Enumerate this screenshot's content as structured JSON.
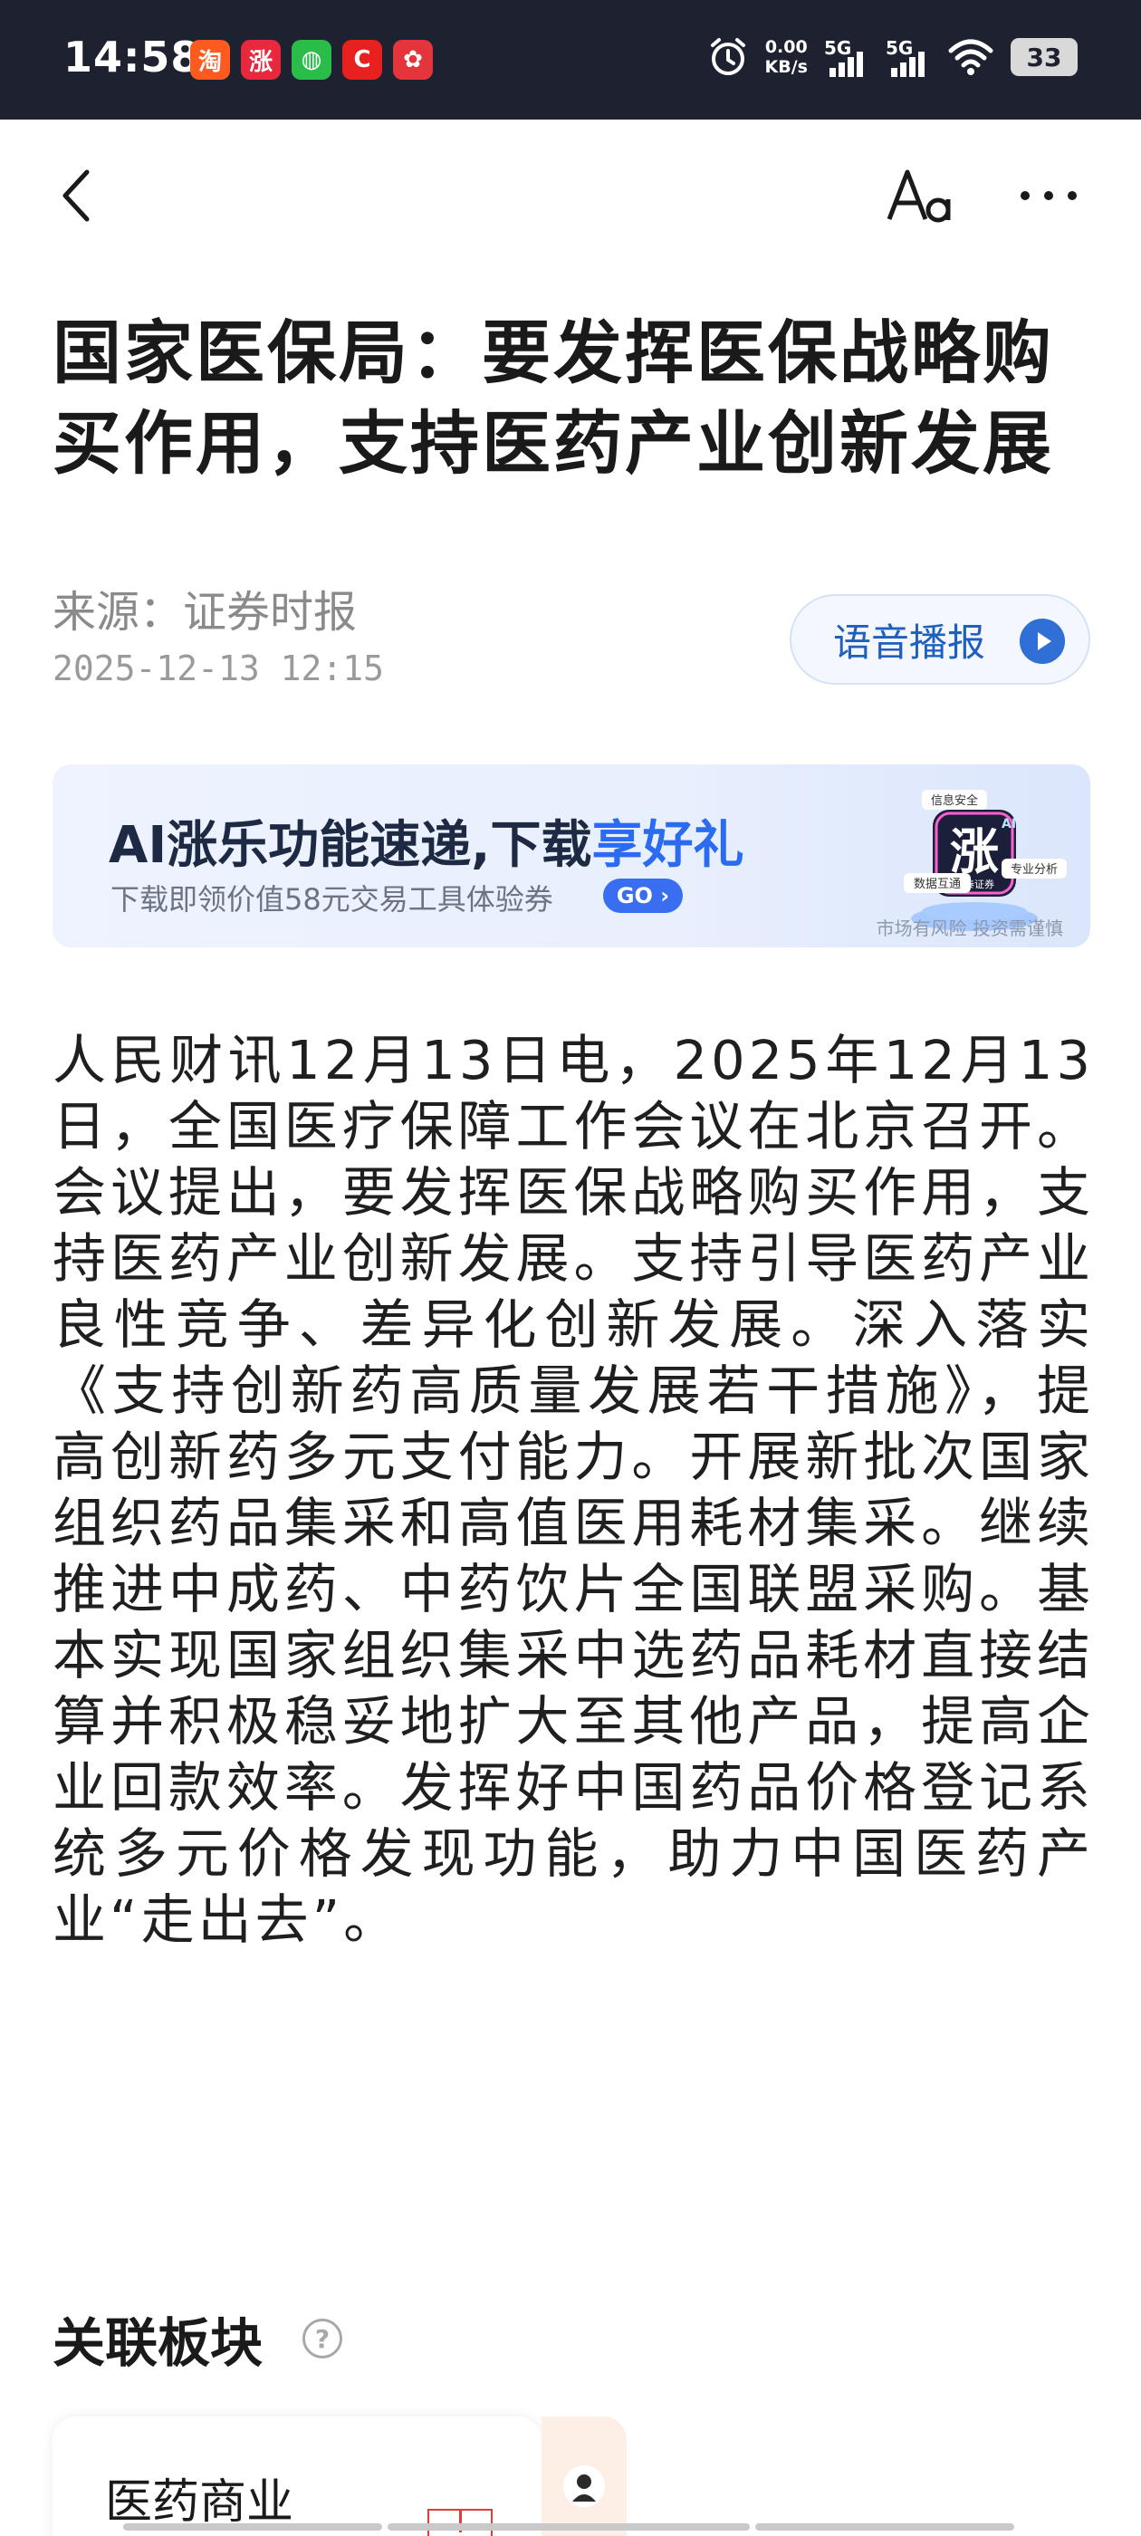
{
  "status_bar": {
    "time": "14:58",
    "apps": [
      {
        "icon": "taobao-app-icon",
        "glyph": "淘",
        "color": "#ff5a1f"
      },
      {
        "icon": "zhangle-app-icon",
        "glyph": "涨",
        "color": "#e8283c"
      },
      {
        "icon": "wechat-app-icon",
        "glyph": "◍",
        "color": "#2bbd4a"
      },
      {
        "icon": "c-app-icon",
        "glyph": "C",
        "color": "#e82020"
      },
      {
        "icon": "red-app-icon",
        "glyph": "✿",
        "color": "#e3353b"
      }
    ],
    "net_speed_value": "0.00",
    "net_speed_unit": "KB/s",
    "signal_1": "5G",
    "signal_2": "5G",
    "battery": "33"
  },
  "nav": {
    "back_icon": "chevron-left-icon",
    "font_icon": "font-size-icon",
    "more_icon": "more-icon"
  },
  "article": {
    "title": "国家医保局：要发挥医保战略购买作用，支持医药产业创新发展",
    "source": "来源：证券时报",
    "datetime": "2025-12-13 12:15",
    "tts_label": "语音播报",
    "body": "人民财讯12月13日电，2025年12月13日，全国医疗保障工作会议在北京召开。会议提出，要发挥医保战略购买作用，支持医药产业创新发展。支持引导医药产业良性竞争、差异化创新发展。深入落实《支持创新药高质量发展若干措施》，提高创新药多元支付能力。开展新批次国家组织药品集采和高值医用耗材集采。继续推进中成药、中药饮片全国联盟采购。基本实现国家组织集采中选药品耗材直接结算并积极稳妥地扩大至其他产品，提高企业回款效率。发挥好中国药品价格登记系统多元价格发现功能，助力中国医药产业“走出去”。"
  },
  "banner": {
    "headline_prefix": "AI涨乐功能速递,下载",
    "headline_highlight": "享好礼",
    "sub": "下载即领价值58元交易工具体验券",
    "go": "GO ›",
    "tag_1": "信息安全",
    "tag_2": "数据互通",
    "tag_3": "专业分析",
    "badge_glyph": "涨",
    "badge_ai": "AI",
    "brand": "华泰证券",
    "disclaimer": "市场有风险 投资需谨慎"
  },
  "related": {
    "title": "关联板块",
    "help": "?",
    "card_label": "医药商业"
  },
  "colors": {
    "status_bg": "#1e2230",
    "accent_blue": "#2a6bf2",
    "text_primary": "#1a1a1a",
    "text_secondary": "#8a8a8a"
  }
}
